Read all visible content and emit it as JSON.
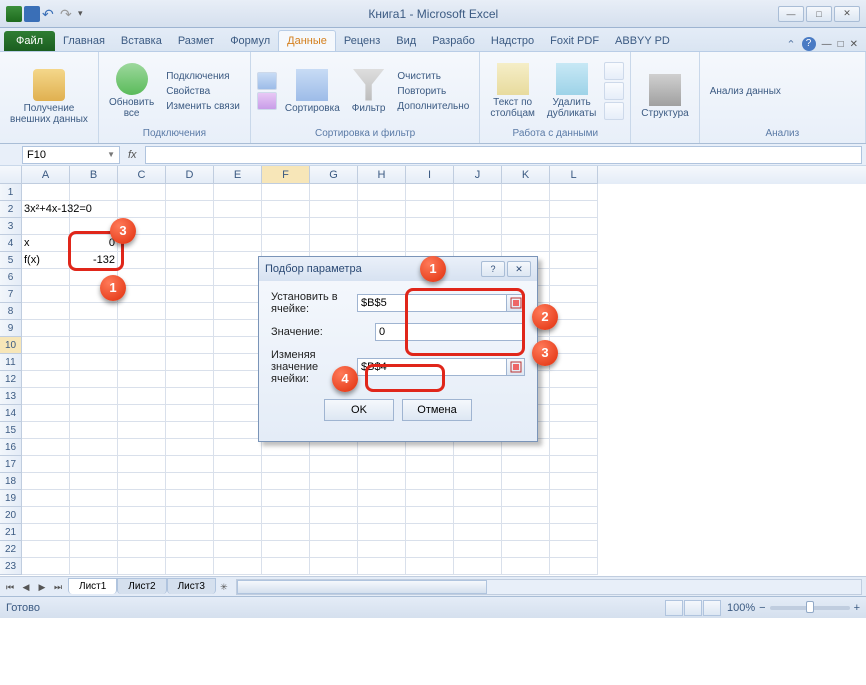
{
  "window": {
    "title": "Книга1 - Microsoft Excel"
  },
  "qat": {
    "dropdown": "▾"
  },
  "tabs": {
    "file": "Файл",
    "items": [
      "Главная",
      "Вставка",
      "Размет",
      "Формул",
      "Данные",
      "Реценз",
      "Вид",
      "Разрабо",
      "Надстро",
      "Foxit PDF",
      "ABBYY PD"
    ],
    "active_index": 4
  },
  "ribbon": {
    "ext_data": "Получение\nвнешних данных",
    "refresh": "Обновить\nвсе",
    "connections_grp": "Подключения",
    "conn_opts": [
      "Подключения",
      "Свойства",
      "Изменить связи"
    ],
    "sort": "Сортировка",
    "filter": "Фильтр",
    "filter_opts": [
      "Очистить",
      "Повторить",
      "Дополнительно"
    ],
    "sortfilter_grp": "Сортировка и фильтр",
    "textcol": "Текст по\nстолбцам",
    "dup": "Удалить\nдубликаты",
    "datatools_grp": "Работа с данными",
    "struct": "Структура",
    "analysis": "Анализ данных",
    "analysis_grp": "Анализ"
  },
  "namebox": "F10",
  "fx": "fx",
  "columns": [
    "A",
    "B",
    "C",
    "D",
    "E",
    "F",
    "G",
    "H",
    "I",
    "J",
    "K",
    "L"
  ],
  "selected_col": "F",
  "selected_row": 10,
  "cells": {
    "a2": "3x²+4x-132=0",
    "a4": "x",
    "b4": "0",
    "a5": "f(x)",
    "b5": "-132"
  },
  "dialog": {
    "title": "Подбор параметра",
    "set_cell_label": "Установить в ячейке:",
    "set_cell_value": "$B$5",
    "value_label": "Значение:",
    "value_value": "0",
    "changing_label": "Изменяя значение ячейки:",
    "changing_value": "$B$4",
    "ok": "OK",
    "cancel": "Отмена",
    "help": "?",
    "close": "✕"
  },
  "sheets": {
    "list": [
      "Лист1",
      "Лист2",
      "Лист3"
    ],
    "active": 0
  },
  "status": {
    "text": "Готово",
    "zoom": "100%"
  },
  "callouts": {
    "c1": "1",
    "c2": "2",
    "c3": "3",
    "c4": "4"
  }
}
